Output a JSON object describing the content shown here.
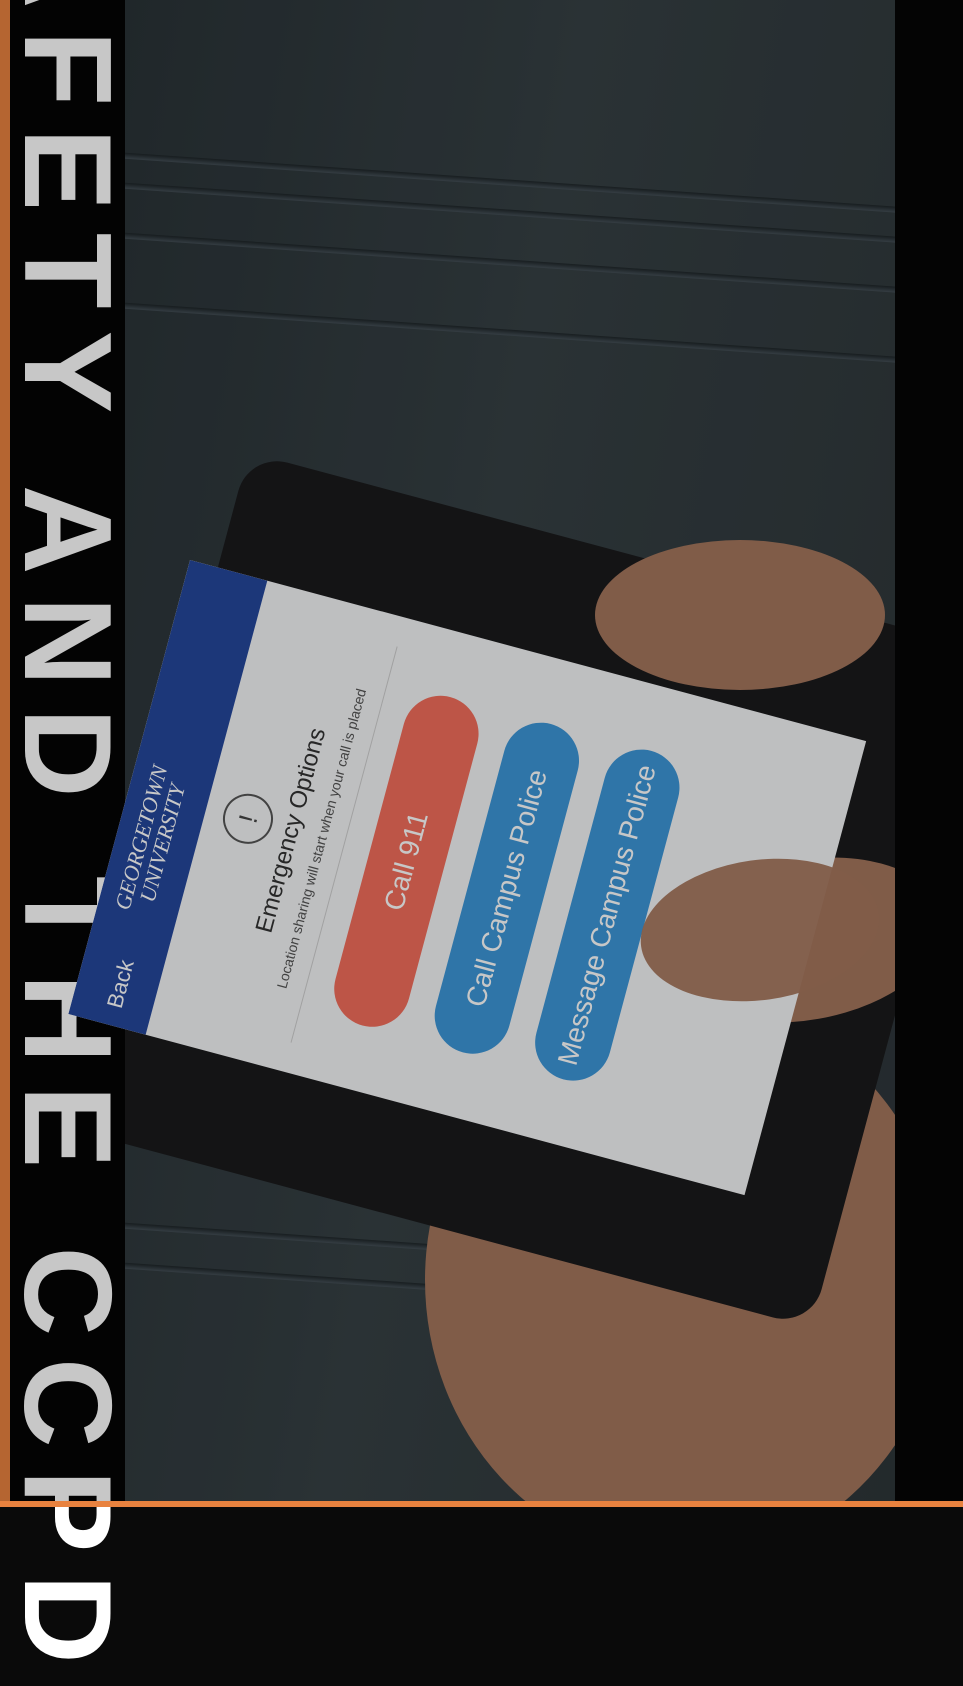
{
  "overlay": {
    "side_title": "SAFETY AND THE CCPD"
  },
  "screen": {
    "nav": {
      "back_label": "Back",
      "logo_line1": "GEORGETOWN",
      "logo_line2": "UNIVERSITY"
    },
    "alert_icon": "exclamation-icon",
    "title": "Emergency Options",
    "subtitle": "Location sharing will start when your call is placed",
    "buttons": [
      {
        "label": "Call 911",
        "color": "#f26d5b"
      },
      {
        "label": "Call Campus Police",
        "color": "#3d96d8"
      },
      {
        "label": "Message Campus Police",
        "color": "#3d96d8"
      }
    ]
  },
  "colors": {
    "frame": "#e8823f",
    "nav": "#25479b",
    "background": "#0a0a0a"
  }
}
